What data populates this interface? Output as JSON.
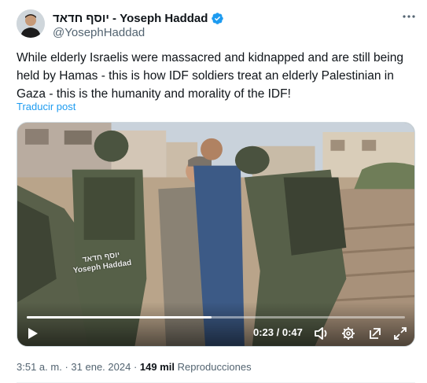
{
  "author": {
    "display_name": "יוסף חדאד - Yoseph Haddad",
    "handle": "@YosephHaddad",
    "verified_icon": "verified-badge-icon",
    "avatar_icon": "avatar"
  },
  "tweet": {
    "text": "While elderly Israelis were massacred and kidnapped and are still being held by Hamas - this is how IDF soldiers treat an elderly Palestinian in Gaza - this is the humanity and morality of the IDF!",
    "translate_label": "Traducir post"
  },
  "video": {
    "watermark_line1": "יוסף חדאד",
    "watermark_line2": "Yoseph Haddad",
    "current_time": "0:23",
    "duration": "0:47",
    "time_display": "0:23 / 0:47",
    "progress_fraction": 0.489
  },
  "meta": {
    "time": "3:51 a. m.",
    "separator": "·",
    "date": "31 ene. 2024",
    "views_count": "149 mil",
    "views_label": "Reproducciones"
  },
  "colors": {
    "link": "#1d9bf0",
    "verified": "#1d9bf0",
    "secondary_text": "#536471"
  }
}
